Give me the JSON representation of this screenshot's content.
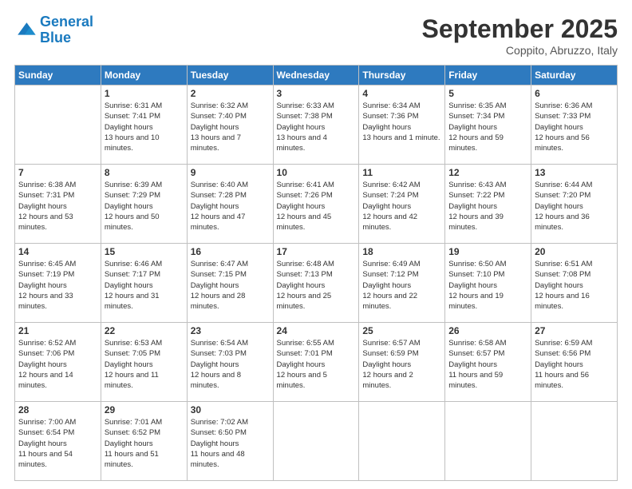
{
  "logo": {
    "line1": "General",
    "line2": "Blue"
  },
  "header": {
    "month": "September 2025",
    "location": "Coppito, Abruzzo, Italy"
  },
  "days_of_week": [
    "Sunday",
    "Monday",
    "Tuesday",
    "Wednesday",
    "Thursday",
    "Friday",
    "Saturday"
  ],
  "weeks": [
    [
      {
        "day": "",
        "info": ""
      },
      {
        "day": "1",
        "sunrise": "6:31 AM",
        "sunset": "7:41 PM",
        "daylight": "13 hours and 10 minutes."
      },
      {
        "day": "2",
        "sunrise": "6:32 AM",
        "sunset": "7:40 PM",
        "daylight": "13 hours and 7 minutes."
      },
      {
        "day": "3",
        "sunrise": "6:33 AM",
        "sunset": "7:38 PM",
        "daylight": "13 hours and 4 minutes."
      },
      {
        "day": "4",
        "sunrise": "6:34 AM",
        "sunset": "7:36 PM",
        "daylight": "13 hours and 1 minute."
      },
      {
        "day": "5",
        "sunrise": "6:35 AM",
        "sunset": "7:34 PM",
        "daylight": "12 hours and 59 minutes."
      },
      {
        "day": "6",
        "sunrise": "6:36 AM",
        "sunset": "7:33 PM",
        "daylight": "12 hours and 56 minutes."
      }
    ],
    [
      {
        "day": "7",
        "sunrise": "6:38 AM",
        "sunset": "7:31 PM",
        "daylight": "12 hours and 53 minutes."
      },
      {
        "day": "8",
        "sunrise": "6:39 AM",
        "sunset": "7:29 PM",
        "daylight": "12 hours and 50 minutes."
      },
      {
        "day": "9",
        "sunrise": "6:40 AM",
        "sunset": "7:28 PM",
        "daylight": "12 hours and 47 minutes."
      },
      {
        "day": "10",
        "sunrise": "6:41 AM",
        "sunset": "7:26 PM",
        "daylight": "12 hours and 45 minutes."
      },
      {
        "day": "11",
        "sunrise": "6:42 AM",
        "sunset": "7:24 PM",
        "daylight": "12 hours and 42 minutes."
      },
      {
        "day": "12",
        "sunrise": "6:43 AM",
        "sunset": "7:22 PM",
        "daylight": "12 hours and 39 minutes."
      },
      {
        "day": "13",
        "sunrise": "6:44 AM",
        "sunset": "7:20 PM",
        "daylight": "12 hours and 36 minutes."
      }
    ],
    [
      {
        "day": "14",
        "sunrise": "6:45 AM",
        "sunset": "7:19 PM",
        "daylight": "12 hours and 33 minutes."
      },
      {
        "day": "15",
        "sunrise": "6:46 AM",
        "sunset": "7:17 PM",
        "daylight": "12 hours and 31 minutes."
      },
      {
        "day": "16",
        "sunrise": "6:47 AM",
        "sunset": "7:15 PM",
        "daylight": "12 hours and 28 minutes."
      },
      {
        "day": "17",
        "sunrise": "6:48 AM",
        "sunset": "7:13 PM",
        "daylight": "12 hours and 25 minutes."
      },
      {
        "day": "18",
        "sunrise": "6:49 AM",
        "sunset": "7:12 PM",
        "daylight": "12 hours and 22 minutes."
      },
      {
        "day": "19",
        "sunrise": "6:50 AM",
        "sunset": "7:10 PM",
        "daylight": "12 hours and 19 minutes."
      },
      {
        "day": "20",
        "sunrise": "6:51 AM",
        "sunset": "7:08 PM",
        "daylight": "12 hours and 16 minutes."
      }
    ],
    [
      {
        "day": "21",
        "sunrise": "6:52 AM",
        "sunset": "7:06 PM",
        "daylight": "12 hours and 14 minutes."
      },
      {
        "day": "22",
        "sunrise": "6:53 AM",
        "sunset": "7:05 PM",
        "daylight": "12 hours and 11 minutes."
      },
      {
        "day": "23",
        "sunrise": "6:54 AM",
        "sunset": "7:03 PM",
        "daylight": "12 hours and 8 minutes."
      },
      {
        "day": "24",
        "sunrise": "6:55 AM",
        "sunset": "7:01 PM",
        "daylight": "12 hours and 5 minutes."
      },
      {
        "day": "25",
        "sunrise": "6:57 AM",
        "sunset": "6:59 PM",
        "daylight": "12 hours and 2 minutes."
      },
      {
        "day": "26",
        "sunrise": "6:58 AM",
        "sunset": "6:57 PM",
        "daylight": "11 hours and 59 minutes."
      },
      {
        "day": "27",
        "sunrise": "6:59 AM",
        "sunset": "6:56 PM",
        "daylight": "11 hours and 56 minutes."
      }
    ],
    [
      {
        "day": "28",
        "sunrise": "7:00 AM",
        "sunset": "6:54 PM",
        "daylight": "11 hours and 54 minutes."
      },
      {
        "day": "29",
        "sunrise": "7:01 AM",
        "sunset": "6:52 PM",
        "daylight": "11 hours and 51 minutes."
      },
      {
        "day": "30",
        "sunrise": "7:02 AM",
        "sunset": "6:50 PM",
        "daylight": "11 hours and 48 minutes."
      },
      {
        "day": "",
        "info": ""
      },
      {
        "day": "",
        "info": ""
      },
      {
        "day": "",
        "info": ""
      },
      {
        "day": "",
        "info": ""
      }
    ]
  ]
}
